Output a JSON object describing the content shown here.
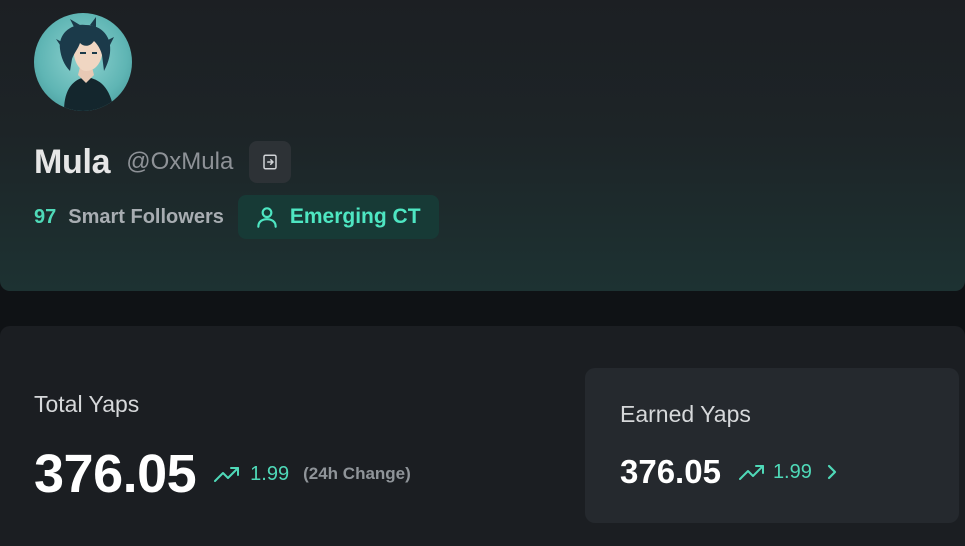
{
  "profile": {
    "name": "Mula",
    "handle": "@OxMula",
    "smart_followers_count": "97",
    "smart_followers_label": "Smart Followers",
    "badge_label": "Emerging CT",
    "avatar_icon": "anime-avatar",
    "login_icon": "login-icon",
    "badge_icon": "user-icon"
  },
  "stats": {
    "total_label": "Total Yaps",
    "total_value": "376.05",
    "total_change": "1.99",
    "total_change_label": "(24h Change)",
    "trend_icon": "trending-up-icon"
  },
  "earned": {
    "label": "Earned Yaps",
    "value": "376.05",
    "change": "1.99",
    "chevron_icon": "chevron-right-icon"
  },
  "colors": {
    "accent": "#4fd9b8",
    "badge_bg": "#173a36",
    "card_bg": "#1b1e22",
    "earned_bg": "#25292e"
  }
}
